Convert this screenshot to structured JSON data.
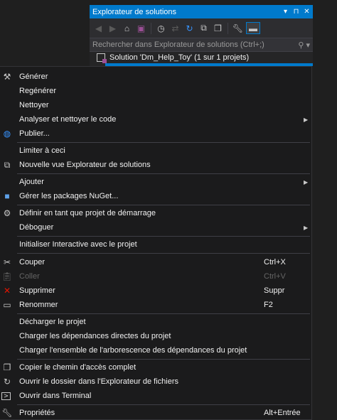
{
  "solution_explorer": {
    "title": "Explorateur de solutions",
    "title_buttons": [
      "▾",
      "⊓",
      "✕"
    ],
    "search_placeholder": "Rechercher dans Explorateur de solutions (Ctrl+;)",
    "solution_label": "Solution 'Dm_Help_Toy' (1 sur 1 projets)"
  },
  "menu": {
    "items": [
      {
        "label": "Générer",
        "icon": "build-icon"
      },
      {
        "label": "Regénérer"
      },
      {
        "label": "Nettoyer"
      },
      {
        "label": "Analyser et nettoyer le code",
        "submenu": true
      },
      {
        "label": "Publier...",
        "icon": "globe-icon"
      },
      {
        "label": "Limiter à ceci"
      },
      {
        "label": "Nouvelle vue Explorateur de solutions",
        "icon": "new-view-icon"
      },
      {
        "label": "Ajouter",
        "submenu": true
      },
      {
        "label": "Gérer les packages NuGet...",
        "icon": "nuget-icon"
      },
      {
        "label": "Définir en tant que projet de démarrage",
        "icon": "gear-icon"
      },
      {
        "label": "Déboguer",
        "submenu": true
      },
      {
        "label": "Initialiser Interactive avec le projet"
      },
      {
        "label": "Couper",
        "icon": "scissors-icon",
        "shortcut": "Ctrl+X"
      },
      {
        "label": "Coller",
        "icon": "paste-icon",
        "shortcut": "Ctrl+V",
        "disabled": true
      },
      {
        "label": "Supprimer",
        "icon": "delete-icon",
        "shortcut": "Suppr"
      },
      {
        "label": "Renommer",
        "icon": "rename-icon",
        "shortcut": "F2"
      },
      {
        "label": "Décharger le projet"
      },
      {
        "label": "Charger les dépendances directes du projet"
      },
      {
        "label": "Charger l'ensemble de l'arborescence des dépendances du projet"
      },
      {
        "label": "Copier le chemin d'accès complet",
        "icon": "copy-icon"
      },
      {
        "label": "Ouvrir le dossier dans l'Explorateur de fichiers",
        "icon": "refresh-arrow-icon"
      },
      {
        "label": "Ouvrir dans Terminal",
        "icon": "terminal-icon"
      },
      {
        "label": "Propriétés",
        "icon": "wrench-icon",
        "shortcut": "Alt+Entrée"
      }
    ]
  },
  "colors": {
    "accent": "#007acc",
    "delete_icon": "#e51400",
    "nuget_icon": "#5ea1e8",
    "globe_icon": "#3794ff",
    "terminal_icon": "#c8c8c8"
  }
}
